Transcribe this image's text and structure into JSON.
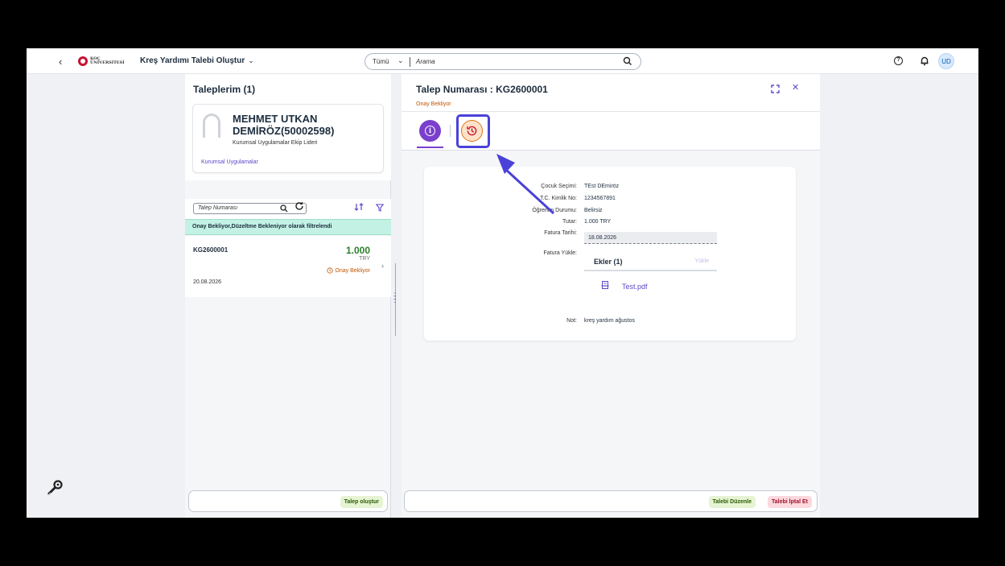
{
  "shell": {
    "back_glyph": "‹",
    "logo_line1": "KOÇ",
    "logo_line2": "ÜNİVERSİTESİ",
    "app_title": "Kreş Yardımı Talebi Oluştur",
    "search_scope": "Tümü",
    "search_placeholder": "Arama",
    "user_initials": "UD",
    "icons": [
      "back-icon",
      "search-icon",
      "help-icon",
      "bell-icon"
    ]
  },
  "list": {
    "title": "Taleplerim (1)",
    "profile": {
      "name": "MEHMET UTKAN DEMİRÖZ(50002598)",
      "role": "Kurumsal Uygulamalar Ekip Lideri",
      "org": "Kurumsal Uygulamalar"
    },
    "filter_placeholder": "Talep Numarası",
    "filter_info": "Onay Bekliyor,Düzeltme Bekleniyor olarak filtrelendi",
    "items": [
      {
        "id": "KG2600001",
        "amount": "1.000",
        "currency": "TRY",
        "status": "Onay Bekliyor",
        "date": "20.08.2026"
      }
    ],
    "footer_button": "Talep oluştur"
  },
  "detail": {
    "title": "Talep Numarası : KG2600001",
    "status": "Onay Bekliyor",
    "tabs": [
      "info-tab",
      "history-tab"
    ],
    "fields": {
      "child_label": "Çocuk Seçimi:",
      "child_value": "TEst DEmiröz",
      "tc_label": "T.C. Kimlik No:",
      "tc_value": "1234567891",
      "edu_label": "Öğrenim Durumu:",
      "edu_value": "Belirsiz",
      "amount_label": "Tutar:",
      "amount_value": "1.000 TRY",
      "invoice_date_label": "Fatura Tarihi:",
      "invoice_date_value": "18.08.2026",
      "invoice_upload_label": "Fatura Yükle:",
      "attachments_title": "Ekler (1)",
      "upload_label": "Yükle",
      "file_name": "Test.pdf",
      "note_label": "Not:",
      "note_value": "kreş yardım ağustos"
    },
    "footer_edit": "Talebi Düzenle",
    "footer_cancel": "Talebi İptal Et"
  },
  "colors": {
    "accent": "#5a48c8",
    "info_tab": "#7a3fcc",
    "history_tab": "#e0731d",
    "status_warning": "#c35500",
    "amount_positive": "#2b7d2b",
    "filter_bar": "#c3f1e4",
    "highlight": "#4a42d8"
  }
}
